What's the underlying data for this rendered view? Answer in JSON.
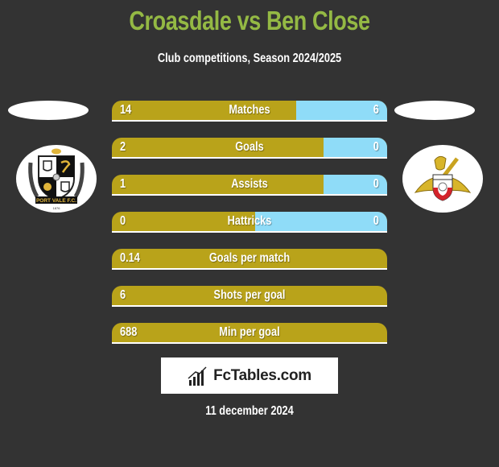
{
  "header": {
    "title": "Croasdale vs Ben Close",
    "subtitle": "Club competitions, Season 2024/2025"
  },
  "teams": {
    "left": {
      "logo_icon": "port-vale-crest-icon",
      "logo_text": "PORT VALE F.C."
    },
    "right": {
      "logo_icon": "doncaster-rovers-crest-icon"
    }
  },
  "colors": {
    "left_bar": "#b9a31a",
    "right_bar": "#8fdcf8",
    "title": "#94b944",
    "background": "#333333"
  },
  "stats": [
    {
      "label": "Matches",
      "left": "14",
      "right": "6",
      "right_share": 0.33
    },
    {
      "label": "Goals",
      "left": "2",
      "right": "0",
      "right_share": 0.23
    },
    {
      "label": "Assists",
      "left": "1",
      "right": "0",
      "right_share": 0.23
    },
    {
      "label": "Hattricks",
      "left": "0",
      "right": "0",
      "right_share": 0.48
    },
    {
      "label": "Goals per match",
      "left": "0.14",
      "right": "",
      "right_share": 0
    },
    {
      "label": "Shots per goal",
      "left": "6",
      "right": "",
      "right_share": 0
    },
    {
      "label": "Min per goal",
      "left": "688",
      "right": "",
      "right_share": 0
    }
  ],
  "footer": {
    "brand": "FcTables.com",
    "brand_icon": "bar-chart-icon",
    "date": "11 december 2024"
  }
}
